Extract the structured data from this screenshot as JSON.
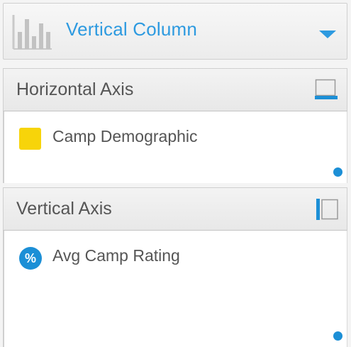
{
  "chart_type": {
    "label": "Vertical Column",
    "icon": "vertical-column-chart-icon",
    "accent_color": "#2d9ae0"
  },
  "horizontal_axis": {
    "title": "Horizontal Axis",
    "icon": "horizontal-axis-icon",
    "fields": [
      {
        "label": "Camp Demographic",
        "icon": "dimension-swatch-icon",
        "color": "#f7d40a"
      }
    ]
  },
  "vertical_axis": {
    "title": "Vertical Axis",
    "icon": "vertical-axis-icon",
    "fields": [
      {
        "label": "Avg Camp Rating",
        "icon": "percent-icon",
        "icon_text": "%",
        "color": "#1c8fd6"
      }
    ]
  }
}
